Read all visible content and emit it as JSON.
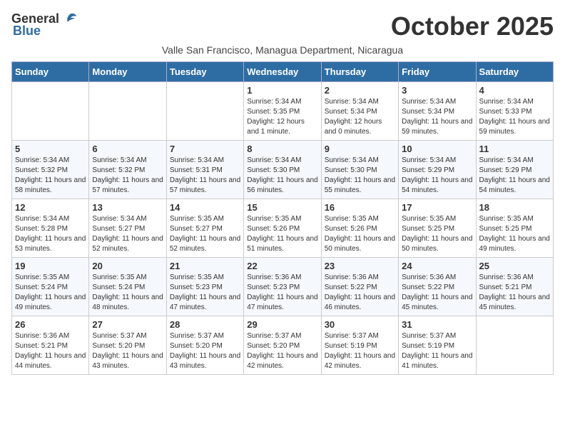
{
  "logo": {
    "general": "General",
    "blue": "Blue"
  },
  "title": "October 2025",
  "subtitle": "Valle San Francisco, Managua Department, Nicaragua",
  "days_of_week": [
    "Sunday",
    "Monday",
    "Tuesday",
    "Wednesday",
    "Thursday",
    "Friday",
    "Saturday"
  ],
  "weeks": [
    [
      {
        "day": "",
        "detail": ""
      },
      {
        "day": "",
        "detail": ""
      },
      {
        "day": "",
        "detail": ""
      },
      {
        "day": "1",
        "detail": "Sunrise: 5:34 AM\nSunset: 5:35 PM\nDaylight: 12 hours\nand 1 minute."
      },
      {
        "day": "2",
        "detail": "Sunrise: 5:34 AM\nSunset: 5:34 PM\nDaylight: 12 hours\nand 0 minutes."
      },
      {
        "day": "3",
        "detail": "Sunrise: 5:34 AM\nSunset: 5:34 PM\nDaylight: 11 hours\nand 59 minutes."
      },
      {
        "day": "4",
        "detail": "Sunrise: 5:34 AM\nSunset: 5:33 PM\nDaylight: 11 hours\nand 59 minutes."
      }
    ],
    [
      {
        "day": "5",
        "detail": "Sunrise: 5:34 AM\nSunset: 5:32 PM\nDaylight: 11 hours\nand 58 minutes."
      },
      {
        "day": "6",
        "detail": "Sunrise: 5:34 AM\nSunset: 5:32 PM\nDaylight: 11 hours\nand 57 minutes."
      },
      {
        "day": "7",
        "detail": "Sunrise: 5:34 AM\nSunset: 5:31 PM\nDaylight: 11 hours\nand 57 minutes."
      },
      {
        "day": "8",
        "detail": "Sunrise: 5:34 AM\nSunset: 5:30 PM\nDaylight: 11 hours\nand 56 minutes."
      },
      {
        "day": "9",
        "detail": "Sunrise: 5:34 AM\nSunset: 5:30 PM\nDaylight: 11 hours\nand 55 minutes."
      },
      {
        "day": "10",
        "detail": "Sunrise: 5:34 AM\nSunset: 5:29 PM\nDaylight: 11 hours\nand 54 minutes."
      },
      {
        "day": "11",
        "detail": "Sunrise: 5:34 AM\nSunset: 5:29 PM\nDaylight: 11 hours\nand 54 minutes."
      }
    ],
    [
      {
        "day": "12",
        "detail": "Sunrise: 5:34 AM\nSunset: 5:28 PM\nDaylight: 11 hours\nand 53 minutes."
      },
      {
        "day": "13",
        "detail": "Sunrise: 5:34 AM\nSunset: 5:27 PM\nDaylight: 11 hours\nand 52 minutes."
      },
      {
        "day": "14",
        "detail": "Sunrise: 5:35 AM\nSunset: 5:27 PM\nDaylight: 11 hours\nand 52 minutes."
      },
      {
        "day": "15",
        "detail": "Sunrise: 5:35 AM\nSunset: 5:26 PM\nDaylight: 11 hours\nand 51 minutes."
      },
      {
        "day": "16",
        "detail": "Sunrise: 5:35 AM\nSunset: 5:26 PM\nDaylight: 11 hours\nand 50 minutes."
      },
      {
        "day": "17",
        "detail": "Sunrise: 5:35 AM\nSunset: 5:25 PM\nDaylight: 11 hours\nand 50 minutes."
      },
      {
        "day": "18",
        "detail": "Sunrise: 5:35 AM\nSunset: 5:25 PM\nDaylight: 11 hours\nand 49 minutes."
      }
    ],
    [
      {
        "day": "19",
        "detail": "Sunrise: 5:35 AM\nSunset: 5:24 PM\nDaylight: 11 hours\nand 49 minutes."
      },
      {
        "day": "20",
        "detail": "Sunrise: 5:35 AM\nSunset: 5:24 PM\nDaylight: 11 hours\nand 48 minutes."
      },
      {
        "day": "21",
        "detail": "Sunrise: 5:35 AM\nSunset: 5:23 PM\nDaylight: 11 hours\nand 47 minutes."
      },
      {
        "day": "22",
        "detail": "Sunrise: 5:36 AM\nSunset: 5:23 PM\nDaylight: 11 hours\nand 47 minutes."
      },
      {
        "day": "23",
        "detail": "Sunrise: 5:36 AM\nSunset: 5:22 PM\nDaylight: 11 hours\nand 46 minutes."
      },
      {
        "day": "24",
        "detail": "Sunrise: 5:36 AM\nSunset: 5:22 PM\nDaylight: 11 hours\nand 45 minutes."
      },
      {
        "day": "25",
        "detail": "Sunrise: 5:36 AM\nSunset: 5:21 PM\nDaylight: 11 hours\nand 45 minutes."
      }
    ],
    [
      {
        "day": "26",
        "detail": "Sunrise: 5:36 AM\nSunset: 5:21 PM\nDaylight: 11 hours\nand 44 minutes."
      },
      {
        "day": "27",
        "detail": "Sunrise: 5:37 AM\nSunset: 5:20 PM\nDaylight: 11 hours\nand 43 minutes."
      },
      {
        "day": "28",
        "detail": "Sunrise: 5:37 AM\nSunset: 5:20 PM\nDaylight: 11 hours\nand 43 minutes."
      },
      {
        "day": "29",
        "detail": "Sunrise: 5:37 AM\nSunset: 5:20 PM\nDaylight: 11 hours\nand 42 minutes."
      },
      {
        "day": "30",
        "detail": "Sunrise: 5:37 AM\nSunset: 5:19 PM\nDaylight: 11 hours\nand 42 minutes."
      },
      {
        "day": "31",
        "detail": "Sunrise: 5:37 AM\nSunset: 5:19 PM\nDaylight: 11 hours\nand 41 minutes."
      },
      {
        "day": "",
        "detail": ""
      }
    ]
  ]
}
